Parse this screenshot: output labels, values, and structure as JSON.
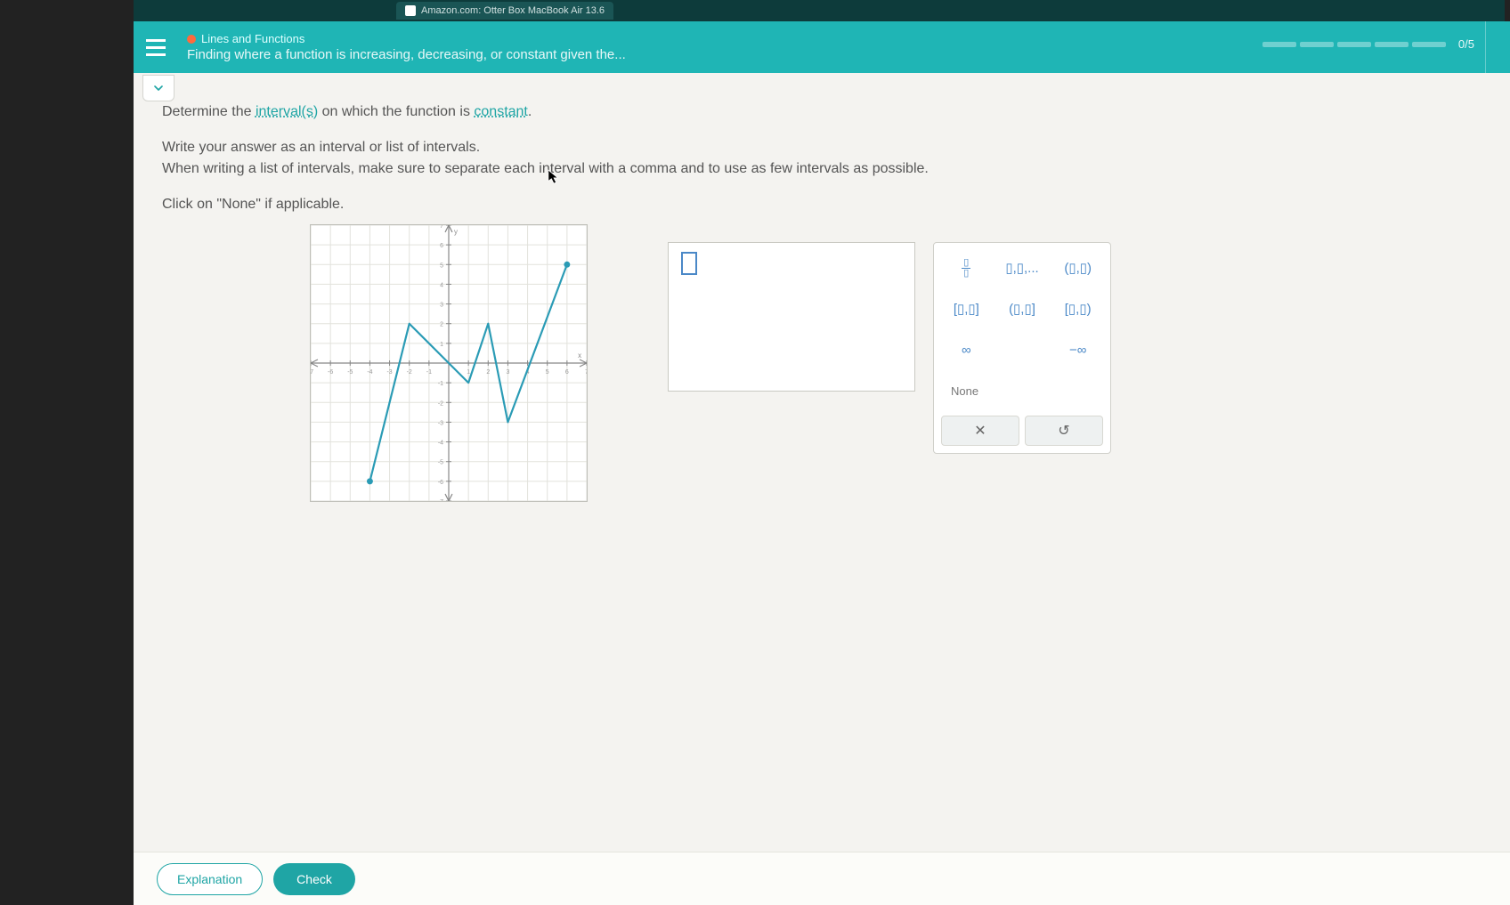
{
  "browser": {
    "tab_title": "Amazon.com: Otter Box MacBook Air 13.6"
  },
  "header": {
    "topic": "Lines and Functions",
    "title": "Finding where a function is increasing, decreasing, or constant given the...",
    "score": "0/5"
  },
  "question": {
    "line1_a": "Determine the ",
    "line1_link1": "interval(s)",
    "line1_b": " on which the function is ",
    "line1_link2": "constant",
    "line1_c": ".",
    "line2": "Write your answer as an interval or list of intervals.",
    "line3": "When writing a list of intervals, make sure to separate each interval with a comma and to use as few intervals as possible.",
    "line4": "Click on \"None\" if applicable."
  },
  "palette": {
    "fraction": "▯/▯",
    "list": "▯,▯,...",
    "open_open": "(▯,▯)",
    "closed_closed": "[▯,▯]",
    "open_closed": "(▯,▯]",
    "closed_open": "[▯,▯)",
    "infinity": "∞",
    "neg_infinity": "−∞",
    "none": "None",
    "clear": "✕",
    "undo": "↺"
  },
  "buttons": {
    "explanation": "Explanation",
    "check": "Check"
  },
  "chart_data": {
    "type": "line",
    "title": "",
    "xlabel": "x",
    "ylabel": "y",
    "xlim": [
      -7,
      7
    ],
    "ylim": [
      -7,
      7
    ],
    "x_ticks": [
      -7,
      -6,
      -5,
      -4,
      -3,
      -2,
      -1,
      0,
      1,
      2,
      3,
      4,
      5,
      6,
      7
    ],
    "y_ticks": [
      -7,
      -6,
      -5,
      -4,
      -3,
      -2,
      -1,
      0,
      1,
      2,
      3,
      4,
      5,
      6,
      7
    ],
    "points": [
      {
        "x": -4,
        "y": -6,
        "endpoint": true
      },
      {
        "x": -2,
        "y": 2
      },
      {
        "x": 1,
        "y": -1
      },
      {
        "x": 2,
        "y": 2
      },
      {
        "x": 3,
        "y": -3
      },
      {
        "x": 6,
        "y": 5,
        "endpoint": true
      }
    ]
  }
}
